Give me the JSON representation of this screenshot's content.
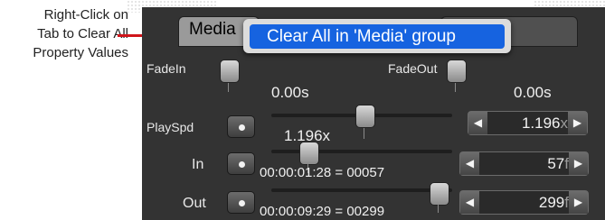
{
  "callout": {
    "lines": [
      "Right-Click on",
      "Tab to Clear All",
      "Property Values"
    ],
    "arrow_color": "#d0151b"
  },
  "tabs": {
    "active_label": "Media"
  },
  "context_menu": {
    "item_label": "Clear All in 'Media' group",
    "highlight_color": "#1663e0"
  },
  "properties": {
    "fadein": {
      "label": "FadeIn",
      "value": "0.00s"
    },
    "fadeout": {
      "label": "FadeOut",
      "value": "0.00s"
    },
    "playspd": {
      "label": "PlaySpd",
      "value": "1.196x",
      "stepper_number": "1.196",
      "stepper_unit": "x"
    },
    "in": {
      "label": "In",
      "value": "00:00:01:28 = 00057",
      "stepper_number": "57",
      "stepper_unit": "f"
    },
    "out": {
      "label": "Out",
      "value": "00:00:09:29 = 00299",
      "stepper_number": "299",
      "stepper_unit": "f"
    }
  },
  "icons": {
    "left": "triangle-left-icon",
    "right": "triangle-right-icon",
    "keyframe": "keyframe-dot-icon"
  },
  "colors": {
    "panel_bg": "#333333",
    "text": "#f0f0f0"
  }
}
